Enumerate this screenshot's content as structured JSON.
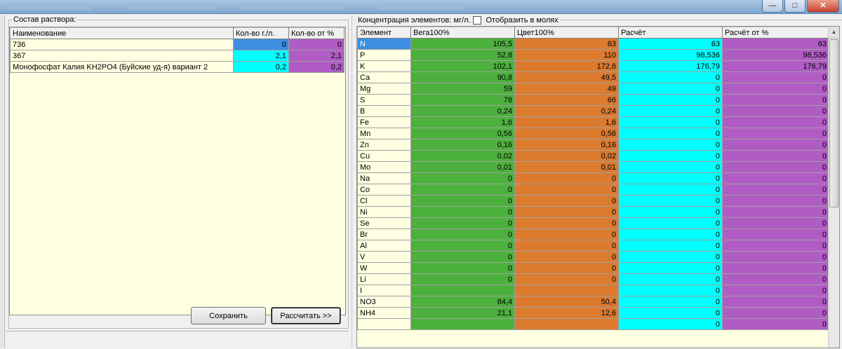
{
  "window": {
    "minimize_icon": "minimize-icon",
    "maximize_icon": "maximize-icon",
    "close_icon": "close-icon"
  },
  "left": {
    "group_label": "Состав раствора:",
    "columns": [
      "Наименование",
      "Кол-во г./л.",
      "Кол-во от %"
    ],
    "rows": [
      {
        "name": "736",
        "qty": "0",
        "pct": "0"
      },
      {
        "name": "367",
        "qty": "2,1",
        "pct": "2,1"
      },
      {
        "name": "Монофосфат Калия KH2PO4 (Буйские уд-я) вариант 2",
        "qty": "0,2",
        "pct": "0,2"
      }
    ],
    "save_label": "Сохранить",
    "calc_label": "Рассчитать >>"
  },
  "right": {
    "group_label": "Концентрация элементов: мг/л.",
    "checkbox_label": "Отобразить в молях",
    "checkbox_checked": false,
    "columns": [
      "Элемент",
      "Вега100%",
      "Цвет100%",
      "Расчёт",
      "Расчёт от %"
    ],
    "rows": [
      {
        "el": "N",
        "vega": "105,5",
        "cvet": "63",
        "calc": "63",
        "pct": "63"
      },
      {
        "el": "P",
        "vega": "52,8",
        "cvet": "110",
        "calc": "98,536",
        "pct": "98,536"
      },
      {
        "el": "K",
        "vega": "102,1",
        "cvet": "172,6",
        "calc": "176,79",
        "pct": "176,79"
      },
      {
        "el": "Ca",
        "vega": "90,8",
        "cvet": "49,5",
        "calc": "0",
        "pct": "0"
      },
      {
        "el": "Mg",
        "vega": "59",
        "cvet": "49",
        "calc": "0",
        "pct": "0"
      },
      {
        "el": "S",
        "vega": "78",
        "cvet": "66",
        "calc": "0",
        "pct": "0"
      },
      {
        "el": "B",
        "vega": "0,24",
        "cvet": "0,24",
        "calc": "0",
        "pct": "0"
      },
      {
        "el": "Fe",
        "vega": "1,6",
        "cvet": "1,6",
        "calc": "0",
        "pct": "0"
      },
      {
        "el": "Mn",
        "vega": "0,56",
        "cvet": "0,56",
        "calc": "0",
        "pct": "0"
      },
      {
        "el": "Zn",
        "vega": "0,16",
        "cvet": "0,16",
        "calc": "0",
        "pct": "0"
      },
      {
        "el": "Cu",
        "vega": "0,02",
        "cvet": "0,02",
        "calc": "0",
        "pct": "0"
      },
      {
        "el": "Mo",
        "vega": "0,01",
        "cvet": "0,01",
        "calc": "0",
        "pct": "0"
      },
      {
        "el": "Na",
        "vega": "0",
        "cvet": "0",
        "calc": "0",
        "pct": "0"
      },
      {
        "el": "Co",
        "vega": "0",
        "cvet": "0",
        "calc": "0",
        "pct": "0"
      },
      {
        "el": "Cl",
        "vega": "0",
        "cvet": "0",
        "calc": "0",
        "pct": "0"
      },
      {
        "el": "Ni",
        "vega": "0",
        "cvet": "0",
        "calc": "0",
        "pct": "0"
      },
      {
        "el": "Se",
        "vega": "0",
        "cvet": "0",
        "calc": "0",
        "pct": "0"
      },
      {
        "el": "Br",
        "vega": "0",
        "cvet": "0",
        "calc": "0",
        "pct": "0"
      },
      {
        "el": "Al",
        "vega": "0",
        "cvet": "0",
        "calc": "0",
        "pct": "0"
      },
      {
        "el": "V",
        "vega": "0",
        "cvet": "0",
        "calc": "0",
        "pct": "0"
      },
      {
        "el": "W",
        "vega": "0",
        "cvet": "0",
        "calc": "0",
        "pct": "0"
      },
      {
        "el": "Li",
        "vega": "0",
        "cvet": "0",
        "calc": "0",
        "pct": "0"
      },
      {
        "el": "I",
        "vega": "",
        "cvet": "",
        "calc": "0",
        "pct": "0"
      },
      {
        "el": "NO3",
        "vega": "84,4",
        "cvet": "50,4",
        "calc": "0",
        "pct": "0"
      },
      {
        "el": "NH4",
        "vega": "21,1",
        "cvet": "12,6",
        "calc": "0",
        "pct": "0"
      },
      {
        "el": "",
        "vega": "",
        "cvet": "",
        "calc": "0",
        "pct": "0"
      }
    ]
  },
  "colors": {
    "selected": "#3b8ee2",
    "cyan": "#00ffff",
    "magenta": "#b05cc4",
    "green": "#4cb13c",
    "orange": "#dc7a2e",
    "grid_bg": "#ffffe1"
  }
}
